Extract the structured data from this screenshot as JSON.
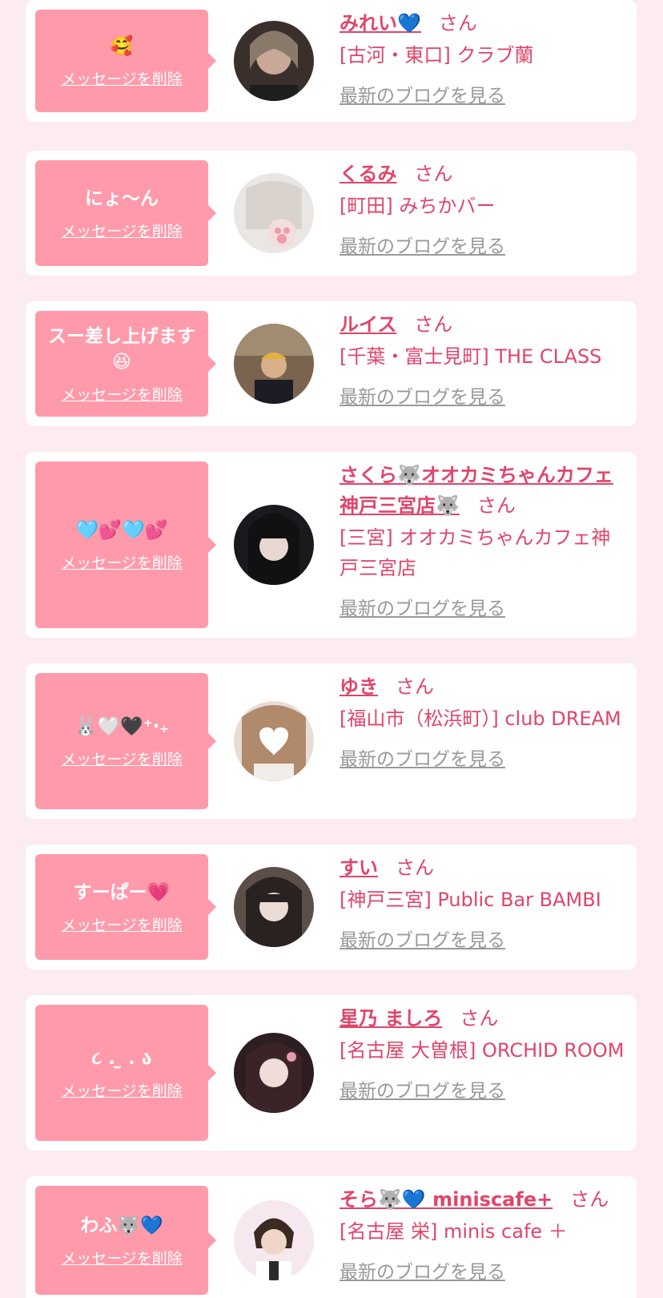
{
  "delete_label": "メッセージを削除",
  "honorific": "さん",
  "blog_label": "最新のブログを見る",
  "colors": {
    "bubble": "#ff9aab",
    "accent": "#e0456a",
    "background": "#fcecef",
    "link_gray": "#999999"
  },
  "entries": [
    {
      "message": "🥰",
      "name": "みれい💙",
      "shop": "[古河・東口] クラブ蘭"
    },
    {
      "message": "にょ〜ん",
      "name": "くるみ",
      "shop": "[町田] みちかバー"
    },
    {
      "message": "スー差し上げます😆",
      "name": "ルイス",
      "shop": "[千葉・富士見町] THE CLASS"
    },
    {
      "message": "🩵💕🩵💕",
      "name": "さくら🐺オオカミちゃんカフェ神戸三宮店🐺",
      "shop": "[三宮] オオカミちゃんカフェ神戸三宮店"
    },
    {
      "message": "🐰🤍🖤⁺‧₊",
      "name": "ゆき",
      "shop": "[福山市（松浜町）] club DREAM"
    },
    {
      "message": "すーぱー💗",
      "name": "すい",
      "shop": "[神戸三宮] Public Bar BAMBI"
    },
    {
      "message": "૮ . ̫ . ა",
      "name": "星乃 ましろ",
      "shop": "[名古屋 大曽根] ORCHID ROOM"
    },
    {
      "message": "わふ🐺💙",
      "name": "そら🐺💙 miniscafe+",
      "shop": "[名古屋 栄] minis cafe ＋"
    }
  ]
}
